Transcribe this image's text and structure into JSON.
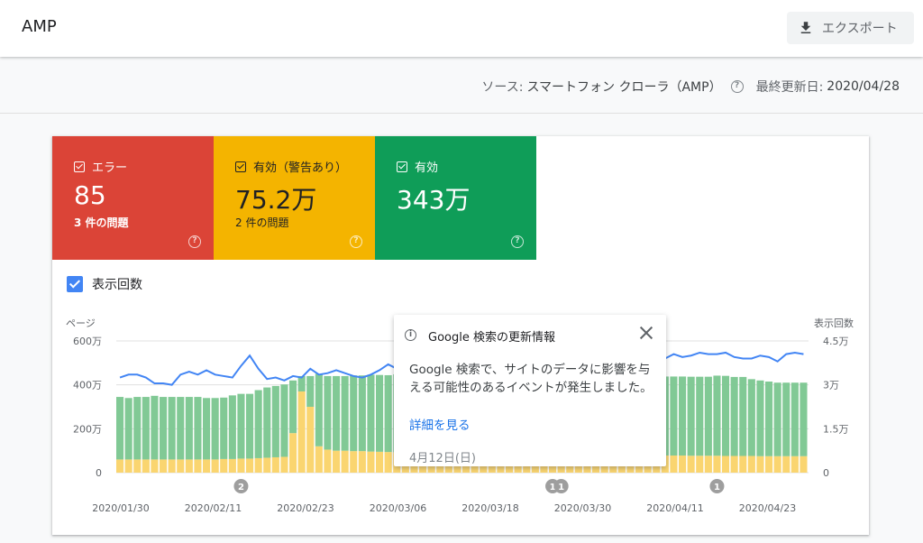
{
  "app": {
    "title": "AMP",
    "export_label": "エクスポート"
  },
  "source": {
    "label": "ソース:",
    "value": "スマートフォン クローラ（AMP）",
    "updated_label": "最終更新日:",
    "updated_value": "2020/04/28"
  },
  "tiles": [
    {
      "label": "エラー",
      "value": "85",
      "sub": "3 件の問題",
      "color": "#db4437"
    },
    {
      "label": "有効（警告あり）",
      "value": "75.2万",
      "sub": "2 件の問題",
      "color": "#f4b400"
    },
    {
      "label": "有効",
      "value": "343万",
      "sub": "",
      "color": "#0f9d58"
    }
  ],
  "impressions_toggle": "表示回数",
  "popup": {
    "title": "Google 検索の更新情報",
    "body": "Google 検索で、サイトのデータに影響を与える可能性のあるイベントが発生しました。",
    "link": "詳細を見る",
    "date": "4月12日(日)"
  },
  "chart_data": {
    "type": "bar",
    "ylabel_left": "ページ",
    "ylabel_right": "表示回数",
    "left_ticks": [
      "0",
      "200万",
      "400万",
      "600万"
    ],
    "right_ticks": [
      "0",
      "1.5万",
      "3万",
      "4.5万"
    ],
    "ylim_left": [
      0,
      6000000
    ],
    "ylim_right": [
      0,
      45000
    ],
    "x_labels": [
      "2020/01/30",
      "2020/02/11",
      "2020/02/23",
      "2020/03/06",
      "2020/03/18",
      "2020/03/30",
      "2020/04/11",
      "2020/04/23"
    ],
    "series": [
      {
        "name": "有効（警告あり）",
        "color": "#fad570",
        "values": [
          600000,
          600000,
          600000,
          600000,
          600000,
          600000,
          600000,
          600000,
          600000,
          600000,
          600000,
          600000,
          620000,
          620000,
          640000,
          640000,
          660000,
          680000,
          700000,
          720000,
          1800000,
          3700000,
          3000000,
          1200000,
          1050000,
          1000000,
          1000000,
          980000,
          980000,
          960000,
          950000,
          940000,
          930000,
          920000,
          910000,
          900000,
          900000,
          900000,
          890000,
          880000,
          880000,
          870000,
          870000,
          860000,
          860000,
          850000,
          850000,
          850000,
          840000,
          840000,
          830000,
          830000,
          820000,
          820000,
          810000,
          810000,
          800000,
          800000,
          800000,
          790000,
          790000,
          790000,
          780000,
          780000,
          780000,
          780000,
          770000,
          770000,
          770000,
          770000,
          760000,
          760000,
          760000,
          760000,
          750000,
          750000,
          750000,
          750000,
          750000,
          750000
        ]
      },
      {
        "name": "有効",
        "color": "#81c995",
        "values": [
          2850000,
          2800000,
          2850000,
          2850000,
          2900000,
          2850000,
          2850000,
          2850000,
          2850000,
          2850000,
          2800000,
          2800000,
          2800000,
          2900000,
          2950000,
          2950000,
          3100000,
          3200000,
          3250000,
          3300000,
          2400000,
          700000,
          1400000,
          3300000,
          3350000,
          3400000,
          3400000,
          3450000,
          3450000,
          3500000,
          3500000,
          3500000,
          3550000,
          3550000,
          3550000,
          3550000,
          3550000,
          3550000,
          3550000,
          3550000,
          3550000,
          3550000,
          3550000,
          3550000,
          3550000,
          3550000,
          3550000,
          3550000,
          3550000,
          3550000,
          3550000,
          3550000,
          3550000,
          3550000,
          3550000,
          3550000,
          3550000,
          3550000,
          3550000,
          3550000,
          3600000,
          3600000,
          3600000,
          3600000,
          3600000,
          3600000,
          3600000,
          3600000,
          3600000,
          3650000,
          3650000,
          3600000,
          3600000,
          3500000,
          3450000,
          3400000,
          3350000,
          3350000,
          3350000,
          3350000
        ]
      },
      {
        "name": "表示回数",
        "color": "#4285f4",
        "values": [
          32500,
          33500,
          33500,
          32500,
          30500,
          30500,
          30000,
          33500,
          34500,
          33500,
          35000,
          33500,
          33000,
          32500,
          36500,
          40000,
          35500,
          32000,
          32500,
          31500,
          33000,
          32500,
          35500,
          33500,
          34000,
          35000,
          34000,
          33000,
          32500,
          33500,
          35000,
          37000,
          35500,
          34000,
          35500,
          36000,
          36000,
          35500,
          36000,
          36500,
          36000,
          36500,
          37000,
          37500,
          38000,
          37500,
          38000,
          38500,
          38000,
          38500,
          38000,
          39000,
          38500,
          38500,
          38000,
          39000,
          38500,
          39500,
          38500,
          39000,
          38500,
          39000,
          39500,
          39000,
          40500,
          39500,
          40000,
          41000,
          40500,
          40500,
          41000,
          39500,
          39000,
          39000,
          40000,
          39500,
          38000,
          40500,
          41000,
          40500
        ]
      }
    ],
    "annotations": [
      {
        "label": "2",
        "x_index": 14
      },
      {
        "label": "1",
        "x_index": 50
      },
      {
        "label": "1",
        "x_index": 51
      },
      {
        "label": "1",
        "x_index": 69
      }
    ]
  }
}
